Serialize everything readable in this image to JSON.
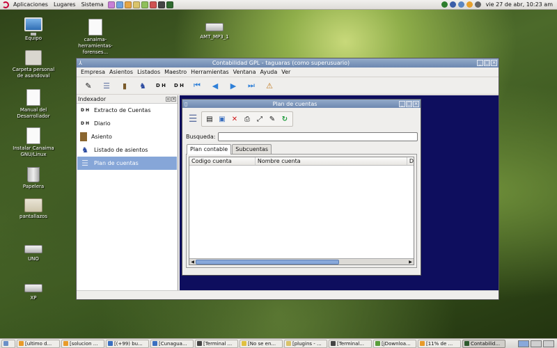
{
  "top_panel": {
    "menus": [
      "Aplicaciones",
      "Lugares",
      "Sistema"
    ],
    "clock": "vie 27 de abr, 10:23 am"
  },
  "desktop_icons": [
    {
      "label": "Equipo"
    },
    {
      "label": "Carpeta personal de asandoval"
    },
    {
      "label": "Manual del Desarrollador"
    },
    {
      "label": "Instalar Canaima GNU/Linux"
    },
    {
      "label": "Papelera"
    },
    {
      "label": "pantallazos"
    },
    {
      "label": "UNO"
    },
    {
      "label": "XP"
    },
    {
      "label": "canaima-herramientas-forenses..."
    },
    {
      "label": "AMT_MP3_1"
    }
  ],
  "main_window": {
    "title": "Contabilidad GPL - taguaras (como superusuario)",
    "menubar": [
      "Empresa",
      "Asientos",
      "Listados",
      "Maestro",
      "Herramientas",
      "Ventana",
      "Ayuda",
      "Ver"
    ],
    "indexer": {
      "title": "Indexador",
      "items": [
        {
          "label": "Extracto de Cuentas",
          "icon": "D H"
        },
        {
          "label": "Diario",
          "icon": "D H"
        },
        {
          "label": "Asiento",
          "icon": "book"
        },
        {
          "label": "Listado de asientos",
          "icon": "figure"
        },
        {
          "label": "Plan de cuentas",
          "icon": "tree"
        }
      ]
    }
  },
  "plan_window": {
    "title": "Plan de cuentas",
    "search_label": "Busqueda:",
    "search_value": "",
    "tabs": [
      "Plan contable",
      "Subcuentas"
    ],
    "columns": [
      "Codigo cuenta",
      "Nombre cuenta",
      "D"
    ]
  },
  "taskbar": {
    "tasks": [
      "[ultimo d...",
      "[solucion ...",
      "[(+99) bu...",
      "[Cunagua...",
      "[Terminal ...",
      "[No se en...",
      "[plugins - ...",
      "[Terminal...",
      "[jDownloa...",
      "[11% de ...",
      "Contabilid..."
    ]
  }
}
